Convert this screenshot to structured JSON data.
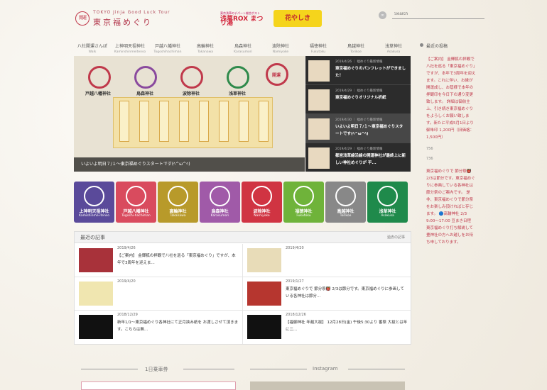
{
  "header": {
    "logo_en": "TOKYO Jinja Good Luck Tour",
    "logo_jp": "東京福めぐり",
    "logo_mark": "開運",
    "banner1_small": "東京浅草のデパート総合ポスト",
    "banner1_main": "浅草ROX まつり湯",
    "banner2": "花やしき",
    "search_placeholder": "Search"
  },
  "nav": [
    {
      "jp": "八社開運さんぽ",
      "en": "Walk"
    },
    {
      "jp": "上神明天祖神社",
      "en": "Kaminshinmeitenso"
    },
    {
      "jp": "戸越八幡神社",
      "en": "Togoshihachiman"
    },
    {
      "jp": "高輪神社",
      "en": "Takanawa"
    },
    {
      "jp": "烏森神社",
      "en": "Karasumori"
    },
    {
      "jp": "波除神社",
      "en": "Namiyoke"
    },
    {
      "jp": "福徳神社",
      "en": "Fukutoku"
    },
    {
      "jp": "鳥越神社",
      "en": "Torikoe"
    },
    {
      "jp": "浅草神社",
      "en": "Asakusa"
    }
  ],
  "slider": {
    "caption": "いよいよ明日７/１〜東京福めぐりスタートです(ﾍ^ω^ﾍ)",
    "stamps": [
      {
        "name": "戸越八幡神社",
        "color": "#c0394b"
      },
      {
        "name": "烏森神社",
        "color": "#8a4a9e"
      },
      {
        "name": "波除神社",
        "color": "#c0394b"
      },
      {
        "name": "浅草神社",
        "color": "#2f8a4b"
      },
      {
        "name": "開運",
        "color": "#c0394b"
      }
    ],
    "items": [
      {
        "date": "2019/4/26 ｜ 福めぐり最新情報",
        "title": "東京福めぐりのパンフレットができました！"
      },
      {
        "date": "2019/4/29 ｜ 福めぐり最新情報",
        "title": "東京福めぐりオリジナル折紙"
      },
      {
        "date": "2019/4/30 ｜ 福めぐり最新情報",
        "title": "いよいよ明日７/１〜東京福めぐりスタートです(ﾍ^ω^ﾍ)"
      },
      {
        "date": "2019/4/29 ｜ 福めぐり最新情報",
        "title": "都営浅草線沿線の開運神社が最終上に新しい神社めぐりが 平..."
      }
    ]
  },
  "tiles": [
    {
      "jp": "上神明天祖神社",
      "en": "Kamishinmei-tenso",
      "color": "#5a4a9a"
    },
    {
      "jp": "戸越八幡神社",
      "en": "Togoshi-hachiman",
      "color": "#d94b5e"
    },
    {
      "jp": "高輪神社",
      "en": "Takanawa",
      "color": "#b89a2a"
    },
    {
      "jp": "烏森神社",
      "en": "Karasumori",
      "color": "#a05aa8"
    },
    {
      "jp": "波除神社",
      "en": "Namiyoke",
      "color": "#d03442"
    },
    {
      "jp": "福徳神社",
      "en": "Fukutoku",
      "color": "#6fb33a"
    },
    {
      "jp": "鳥越神社",
      "en": "Torikoe",
      "color": "#888888"
    },
    {
      "jp": "浅草神社",
      "en": "Asakusa",
      "color": "#1f8a4b"
    }
  ],
  "recent": {
    "title": "最近の記事",
    "more": "過去の記事",
    "posts": [
      {
        "date": "2019/4/26",
        "title": "【ご案内】 金輝狐の拝観で八社を巡る「東京福めぐり」ですが、本年で3周年を迎えま..."
      },
      {
        "date": "2019/4/20",
        "title": ""
      },
      {
        "date": "2019/4/20",
        "title": ""
      },
      {
        "date": "2019/1/27",
        "title": "東京福めぐりで 節分祭👹 2/3は節分です。東京福めぐりに参画している各神社は節分..."
      },
      {
        "date": "2018/12/29",
        "title": "新年1/1〜東京福めぐり各神社にて正月挟み紙を お渡しさせて頂きます。こちらは無..."
      },
      {
        "date": "2018/12/26",
        "title": "【福御神社 年越大祓】 12月28日(金) 午後5:30より 番祭 大祓とは年に二..."
      }
    ]
  },
  "bottom": {
    "left_heading": "1日乗車券",
    "right_heading": "Instagram"
  },
  "sidebar": {
    "title": "最近の投稿",
    "post1": "【ご案内】 金輝狐の拝観で八社を巡る「東京福めぐり」ですが、本年で3周年を迎えます。これに伴い、お縁が開運成し、お蔭様で本年の拝観印を今日下の通り変更致します。 詳細は御前主上、引き続き東京福めぐりをよろしくお願い致します。新たに平成5月1日より 御朱印 1,200円（旧価格：1,500円）",
    "num1": "756",
    "num2": "736",
    "post2": "東京福めぐりで 節分祭👹 2/3は節分です。東京福めぐりに参画している各神社は節分祭のご案内です。 是非、東京福めぐりで節分祭をお楽しみ頂ければと存じます。 🔵高輪神社 2/3 9:00〜17:00 豆まき日程 東京福めぐり打ち解説して豊神社の方へお越しをお待ち申しております。"
  }
}
